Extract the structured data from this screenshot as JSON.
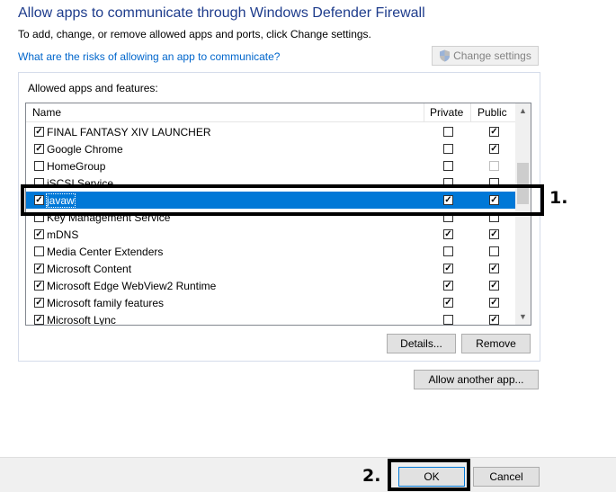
{
  "header": {
    "title": "Allow apps to communicate through Windows Defender Firewall",
    "subtitle": "To add, change, or remove allowed apps and ports, click Change settings.",
    "risk_link": "What are the risks of allowing an app to communicate?",
    "change_settings": "Change settings"
  },
  "list": {
    "group_label": "Allowed apps and features:",
    "columns": {
      "name": "Name",
      "private": "Private",
      "public": "Public"
    },
    "rows": [
      {
        "name": "FINAL FANTASY XIV LAUNCHER",
        "enabled": true,
        "private": false,
        "public": true
      },
      {
        "name": "Google Chrome",
        "enabled": true,
        "private": false,
        "public": true
      },
      {
        "name": "HomeGroup",
        "enabled": false,
        "private": false,
        "public": false
      },
      {
        "name": "iSCSI Service",
        "enabled": false,
        "private": false,
        "public": false
      },
      {
        "name": "javaw",
        "enabled": true,
        "private": true,
        "public": true,
        "selected": true
      },
      {
        "name": "Key Management Service",
        "enabled": false,
        "private": false,
        "public": false
      },
      {
        "name": "mDNS",
        "enabled": true,
        "private": true,
        "public": true
      },
      {
        "name": "Media Center Extenders",
        "enabled": false,
        "private": false,
        "public": false
      },
      {
        "name": "Microsoft Content",
        "enabled": true,
        "private": true,
        "public": true
      },
      {
        "name": "Microsoft Edge WebView2 Runtime",
        "enabled": true,
        "private": true,
        "public": true
      },
      {
        "name": "Microsoft family features",
        "enabled": true,
        "private": true,
        "public": true
      },
      {
        "name": "Microsoft Lync",
        "enabled": true,
        "private": false,
        "public": true
      }
    ]
  },
  "buttons": {
    "details": "Details...",
    "remove": "Remove",
    "allow_another": "Allow another app...",
    "ok": "OK",
    "cancel": "Cancel"
  },
  "annotations": {
    "step1": "1.",
    "step2": "2."
  }
}
